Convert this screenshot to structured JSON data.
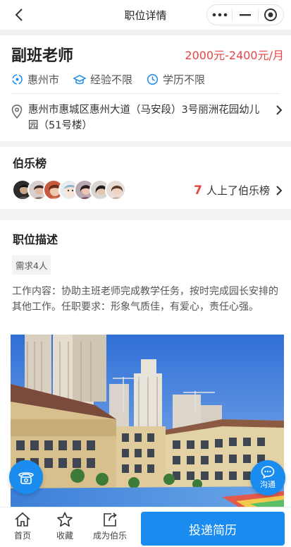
{
  "nav": {
    "title": "职位详情"
  },
  "job": {
    "title": "副班老师",
    "salary": "2000元-2400元/月",
    "tags": [
      {
        "icon": "location-ring-icon",
        "label": "惠州市"
      },
      {
        "icon": "graduation-cap-icon",
        "label": "经验不限"
      },
      {
        "icon": "clock-icon",
        "label": "学历不限"
      }
    ],
    "address": "惠州市惠城区惠州大道（马安段）3号丽洲花园幼儿园（51号楼）"
  },
  "bole": {
    "title": "伯乐榜",
    "count": "7",
    "count_suffix": "人上了伯乐榜"
  },
  "description": {
    "title": "职位描述",
    "need": "需求4人",
    "text": "工作内容：协助主班老师完成教学任务，按时完成园长安排的其他工作。任职要求：形象气质佳，有爱心，责任心强。"
  },
  "fab": {
    "chat_label": "沟通"
  },
  "bottom": {
    "home": "首页",
    "favorite": "收藏",
    "become_bole": "成为伯乐",
    "apply": "投递简历"
  },
  "colors": {
    "accent": "#1a8cf0",
    "salary": "#e64545"
  }
}
